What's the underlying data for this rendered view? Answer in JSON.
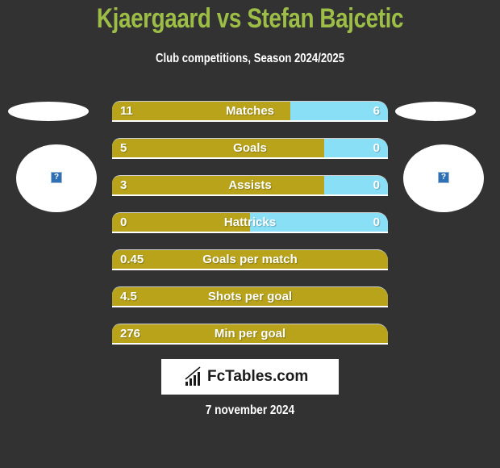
{
  "header": {
    "title": "Kjaergaard vs Stefan Bajcetic",
    "subtitle": "Club competitions, Season 2024/2025"
  },
  "players": {
    "left": {
      "name": "Kjaergaard",
      "avatar_icon": "image-placeholder-icon",
      "placeholder_glyph": "?"
    },
    "right": {
      "name": "Stefan Bajcetic",
      "avatar_icon": "image-placeholder-icon",
      "placeholder_glyph": "?"
    }
  },
  "colors": {
    "background": "#323232",
    "title": "#9cbd46",
    "left_bar": "#b8a31a",
    "right_bar": "#89dff5",
    "text": "#ffffff"
  },
  "stats": [
    {
      "label": "Matches",
      "left": "11",
      "right": "6",
      "left_share": 0.647
    },
    {
      "label": "Goals",
      "left": "5",
      "right": "0",
      "left_share": 0.77
    },
    {
      "label": "Assists",
      "left": "3",
      "right": "0",
      "left_share": 0.77
    },
    {
      "label": "Hattricks",
      "left": "0",
      "right": "0",
      "left_share": 0.5
    },
    {
      "label": "Goals per match",
      "left": "0.45",
      "right": "",
      "left_share": 1.0
    },
    {
      "label": "Shots per goal",
      "left": "4.5",
      "right": "",
      "left_share": 1.0
    },
    {
      "label": "Min per goal",
      "left": "276",
      "right": "",
      "left_share": 1.0
    }
  ],
  "footer": {
    "logo_text": "FcTables.com",
    "logo_icon": "bar-chart-icon",
    "date": "7 november 2024"
  }
}
